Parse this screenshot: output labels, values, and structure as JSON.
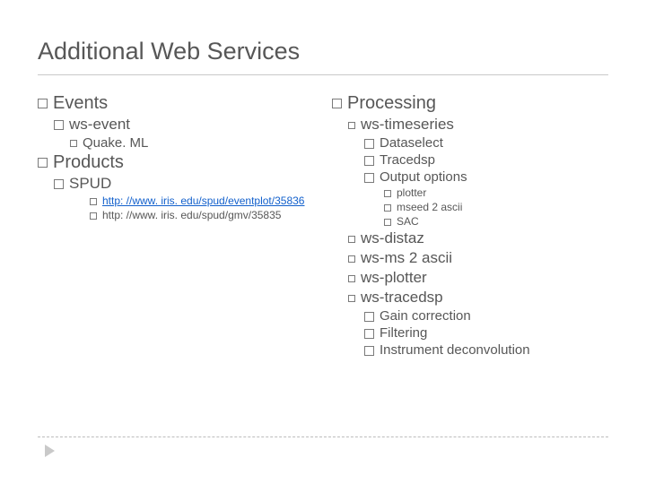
{
  "title": "Additional Web Services",
  "left": {
    "events": {
      "label": "Events",
      "ws_event": {
        "label": "ws-event",
        "quakeml": "Quake. ML"
      }
    },
    "products": {
      "label": "Products",
      "spud": {
        "label": "SPUD",
        "link1": "http: //www. iris. edu/spud/eventplot/35836",
        "link2": "http: //www. iris. edu/spud/gmv/35835"
      }
    }
  },
  "right": {
    "processing": {
      "label": "Processing",
      "ts": {
        "label": "ws-timeseries",
        "dataselect": "Dataselect",
        "tracedsp": "Tracedsp",
        "output": {
          "label": "Output options",
          "plotter": "plotter",
          "mseed": "mseed 2 ascii",
          "sac": "SAC"
        }
      },
      "distaz": "ws-distaz",
      "ms2ascii": "ws-ms 2 ascii",
      "plotter": "ws-plotter",
      "tracedsp2": {
        "label": "ws-tracedsp",
        "gain": "Gain correction",
        "filtering": "Filtering",
        "instrument": "Instrument deconvolution"
      }
    }
  }
}
